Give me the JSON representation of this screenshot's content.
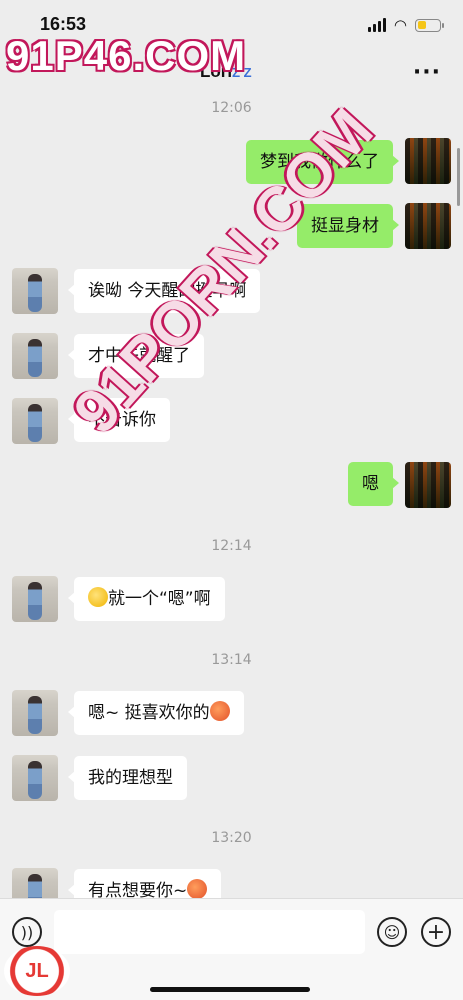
{
  "status_bar": {
    "time": "16:53"
  },
  "nav": {
    "title": "Lori",
    "title_suffix": "Z Z",
    "more": "···"
  },
  "watermark": {
    "top": "91P46.COM",
    "diagonal": "91PORN.COM",
    "logo": "JL"
  },
  "messages": [
    {
      "type": "timestamp",
      "text": "12:06"
    },
    {
      "type": "self",
      "text": "梦到我做什么了"
    },
    {
      "type": "self",
      "text": "挺显身材"
    },
    {
      "type": "other",
      "text": "诶呦  今天醒的挺早啊"
    },
    {
      "type": "other",
      "text": "才中午就醒了"
    },
    {
      "type": "other",
      "text": "不告诉你"
    },
    {
      "type": "self",
      "text": "嗯"
    },
    {
      "type": "timestamp",
      "text": "12:14"
    },
    {
      "type": "other",
      "text": "就一个“嗯”啊",
      "emoji": "smirk-emoji"
    },
    {
      "type": "timestamp",
      "text": "13:14"
    },
    {
      "type": "other",
      "text": "嗯~  挺喜欢你的",
      "emoji": "flushed-emoji"
    },
    {
      "type": "other",
      "text": "我的理想型"
    },
    {
      "type": "timestamp",
      "text": "13:20"
    },
    {
      "type": "other",
      "text": "有点想要你~",
      "emoji": "flushed-emoji"
    }
  ],
  "input_bar": {
    "voice": "voice-icon",
    "emoji": "emoji-icon",
    "plus": "plus-icon"
  },
  "colors": {
    "self_bubble": "#95ec69",
    "other_bubble": "#ffffff",
    "background": "#ededed"
  }
}
